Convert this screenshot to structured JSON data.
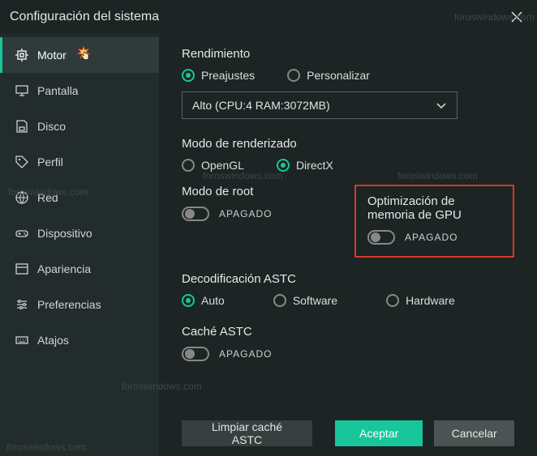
{
  "title": "Configuración del sistema",
  "sidebar": {
    "items": [
      {
        "label": "Motor"
      },
      {
        "label": "Pantalla"
      },
      {
        "label": "Disco"
      },
      {
        "label": "Perfil"
      },
      {
        "label": "Red"
      },
      {
        "label": "Dispositivo"
      },
      {
        "label": "Apariencia"
      },
      {
        "label": "Preferencias"
      },
      {
        "label": "Atajos"
      }
    ]
  },
  "performance": {
    "heading": "Rendimiento",
    "presets": "Preajustes",
    "custom": "Personalizar",
    "preset_value": "Alto (CPU:4 RAM:3072MB)"
  },
  "render_mode": {
    "heading": "Modo de renderizado",
    "opengl": "OpenGL",
    "directx": "DirectX"
  },
  "root_mode": {
    "heading": "Modo de root",
    "state": "APAGADO"
  },
  "gpu_mem": {
    "heading": "Optimización de memoria de GPU",
    "state": "APAGADO"
  },
  "astc_decode": {
    "heading": "Decodificación ASTC",
    "auto": "Auto",
    "software": "Software",
    "hardware": "Hardware"
  },
  "astc_cache": {
    "heading": "Caché ASTC",
    "state": "APAGADO"
  },
  "footer": {
    "clear": "Limpiar caché ASTC",
    "accept": "Aceptar",
    "cancel": "Cancelar"
  },
  "watermark": "foroswindows.com"
}
